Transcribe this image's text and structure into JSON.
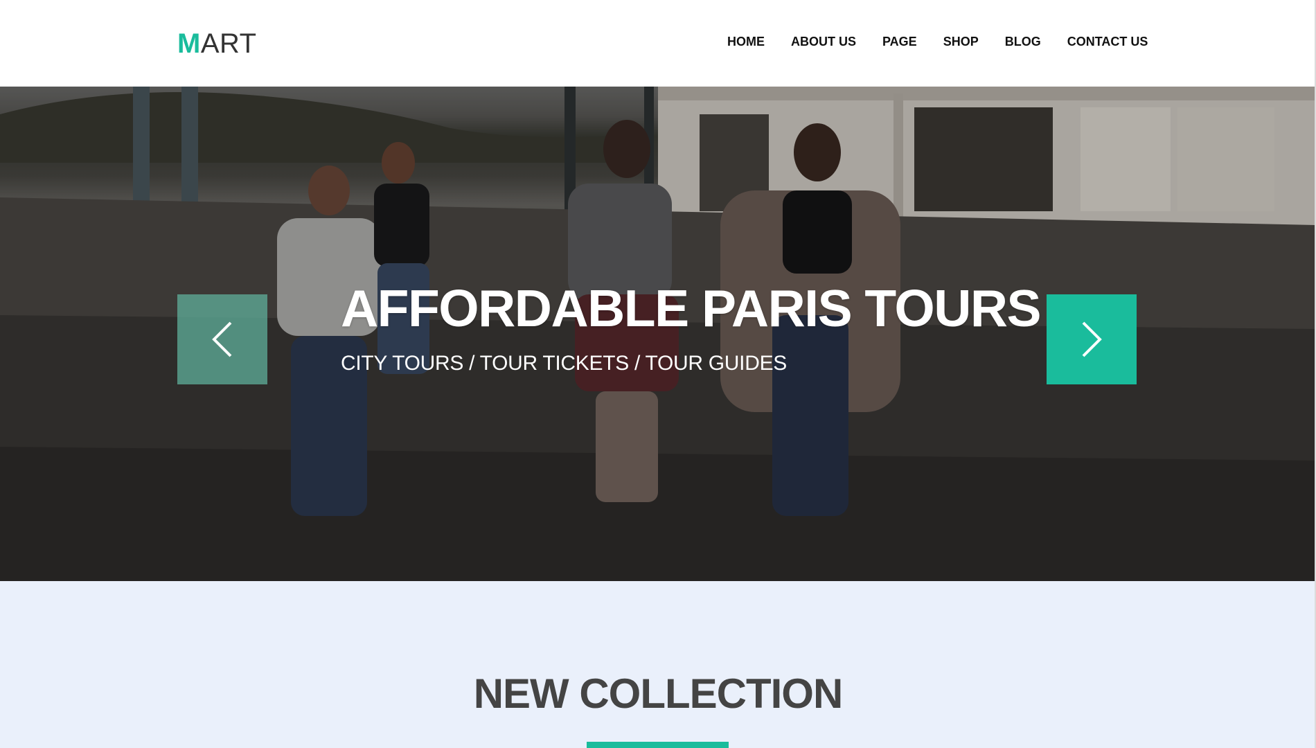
{
  "header": {
    "logo": {
      "accent": "M",
      "rest": "ART"
    },
    "nav": [
      {
        "label": "HOME"
      },
      {
        "label": "ABOUT US"
      },
      {
        "label": "PAGE"
      },
      {
        "label": "SHOP"
      },
      {
        "label": "BLOG"
      },
      {
        "label": "CONTACT US"
      }
    ]
  },
  "hero": {
    "title": "AFFORDABLE PARIS TOURS",
    "subtitle": "CITY TOURS / TOUR TICKETS / TOUR GUIDES",
    "prev_icon": "chevron-left-icon",
    "next_icon": "chevron-right-icon"
  },
  "collection": {
    "title": "NEW COLLECTION"
  },
  "colors": {
    "accent": "#1abc9c",
    "nav_text": "#111111",
    "collection_bg": "#eaf0fb",
    "collection_title": "#444444"
  }
}
